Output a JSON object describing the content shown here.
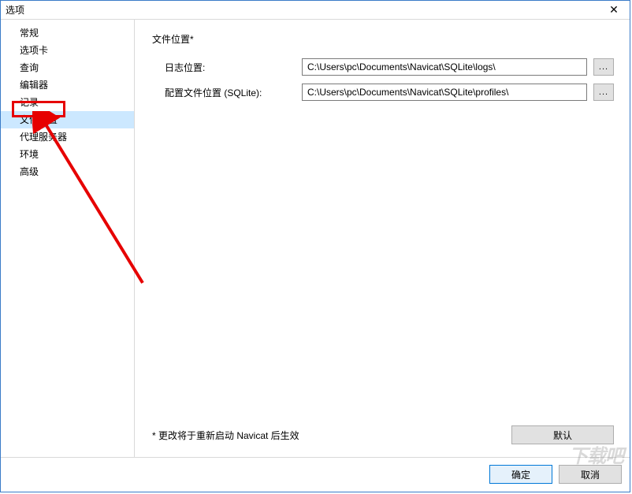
{
  "window": {
    "title": "选项"
  },
  "sidebar": {
    "items": [
      {
        "label": "常规"
      },
      {
        "label": "选项卡"
      },
      {
        "label": "查询"
      },
      {
        "label": "编辑器"
      },
      {
        "label": "记录"
      },
      {
        "label": "文件位置",
        "selected": true
      },
      {
        "label": "代理服务器"
      },
      {
        "label": "环境"
      },
      {
        "label": "高级"
      }
    ]
  },
  "content": {
    "section_title": "文件位置*",
    "rows": [
      {
        "label": "日志位置:",
        "value": "C:\\Users\\pc\\Documents\\Navicat\\SQLite\\logs\\"
      },
      {
        "label": "配置文件位置 (SQLite):",
        "value": "C:\\Users\\pc\\Documents\\Navicat\\SQLite\\profiles\\"
      }
    ],
    "browse_label": "...",
    "note": "* 更改将于重新启动 Navicat 后生效",
    "restore_label": "默认"
  },
  "buttons": {
    "ok": "确定",
    "cancel": "取消"
  },
  "watermark": "下载吧"
}
